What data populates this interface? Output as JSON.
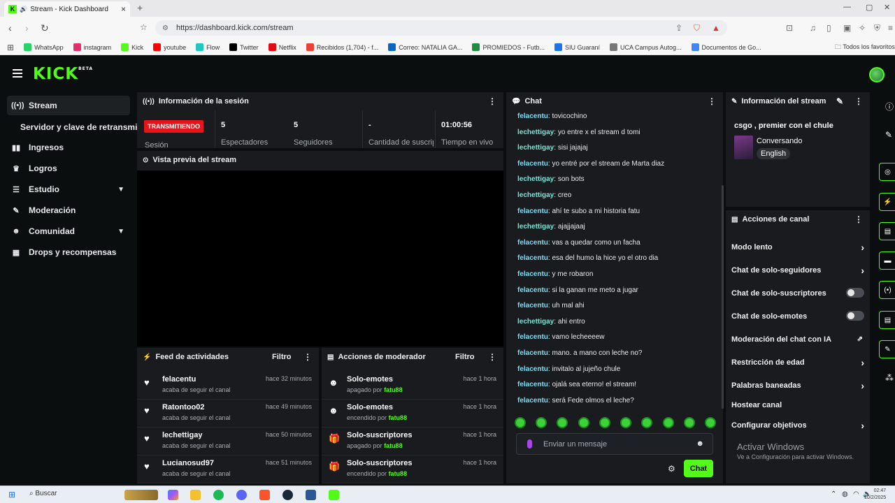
{
  "browser": {
    "tab_title": "Stream - Kick Dashboard",
    "url": "https://dashboard.kick.com/stream",
    "bookmarks": [
      "WhatsApp",
      "instagram",
      "Kick",
      "youtube",
      "Flow",
      "Twitter",
      "Netflix",
      "Recibidos (1,704) - f...",
      "Correo: NATALIA GA...",
      "PROMIEDOS - Futb...",
      "SIU Guaraní",
      "UCA Campus Autog...",
      "Documentos de Go..."
    ],
    "bookmark_colors": [
      "#25d366",
      "#e1306c",
      "#53fc18",
      "#ff0000",
      "#1fc9c1",
      "#000000",
      "#e50914",
      "#ea4335",
      "#0a66c2",
      "#1e8e3e",
      "#1a73e8",
      "#777777",
      "#4285f4"
    ],
    "other_bookmarks": "Todos los favoritos"
  },
  "kick": {
    "logo": "KICK",
    "logo_badge": "BETA"
  },
  "sidebar": {
    "items": [
      {
        "label": "Stream",
        "icon": "broadcast-icon",
        "glyph": "((•))"
      },
      {
        "label": "Ingresos",
        "icon": "chart-icon",
        "glyph": "▮"
      },
      {
        "label": "Logros",
        "icon": "trophy-icon",
        "glyph": "🏆"
      },
      {
        "label": "Estudio",
        "icon": "tune-icon",
        "glyph": "≡"
      },
      {
        "label": "Moderación",
        "icon": "wrench-icon",
        "glyph": "🔧"
      },
      {
        "label": "Comunidad",
        "icon": "people-icon",
        "glyph": "👥"
      },
      {
        "label": "Drops y recompensas",
        "icon": "gift-chart-icon",
        "glyph": "▦"
      }
    ],
    "sub_item": "Servidor y clave de retransmisión"
  },
  "session": {
    "title": "Información de la sesión",
    "status_badge": "TRANSMITIENDO",
    "status_label": "Sesión",
    "stats": [
      {
        "value": "5",
        "label": "Espectadores"
      },
      {
        "value": "5",
        "label": "Seguidores"
      },
      {
        "value": "-",
        "label": "Cantidad de suscripciones"
      },
      {
        "value": "01:00:56",
        "label": "Tiempo en vivo"
      }
    ],
    "preview_title": "Vista previa del stream"
  },
  "activity_feed": {
    "title": "Feed de actividades",
    "filter": "Filtro",
    "rows": [
      {
        "name": "felacentu",
        "sub": "acaba de seguir el canal",
        "time": "hace 32 minutos"
      },
      {
        "name": "Ratontoo02",
        "sub": "acaba de seguir el canal",
        "time": "hace 49 minutos"
      },
      {
        "name": "lechettigay",
        "sub": "acaba de seguir el canal",
        "time": "hace 50 minutos"
      },
      {
        "name": "Lucianosud97",
        "sub": "acaba de seguir el canal",
        "time": "hace 51 minutos"
      }
    ]
  },
  "mod_actions": {
    "title": "Acciones de moderador",
    "filter": "Filtro",
    "rows": [
      {
        "name": "Solo-emotes",
        "state": "apagado por",
        "by": "fatu88",
        "time": "hace 1 hora",
        "icon": "emote-icon"
      },
      {
        "name": "Solo-emotes",
        "state": "encendido por",
        "by": "fatu88",
        "time": "hace 1 hora",
        "icon": "emote-icon"
      },
      {
        "name": "Solo-suscriptores",
        "state": "apagado por",
        "by": "fatu88",
        "time": "hace 1 hora",
        "icon": "gift-icon"
      },
      {
        "name": "Solo-suscriptores",
        "state": "encendido por",
        "by": "fatu88",
        "time": "hace 1 hora",
        "icon": "gift-icon"
      }
    ]
  },
  "chat": {
    "title": "Chat",
    "messages": [
      {
        "user": "felacentu",
        "text": "tovicochino"
      },
      {
        "user": "lechettigay",
        "text": "yo entre x el stream d tomi"
      },
      {
        "user": "lechettigay",
        "text": "sisi jajajaj"
      },
      {
        "user": "felacentu",
        "text": "yo entré por el stream de Marta diaz"
      },
      {
        "user": "lechettigay",
        "text": "son bots"
      },
      {
        "user": "lechettigay",
        "text": "creo"
      },
      {
        "user": "felacentu",
        "text": "ahí te subo a mi historia fatu"
      },
      {
        "user": "lechettigay",
        "text": "ajajjajaaj"
      },
      {
        "user": "felacentu",
        "text": "vas a quedar como un facha"
      },
      {
        "user": "felacentu",
        "text": "esa del humo la hice yo el otro dia"
      },
      {
        "user": "felacentu",
        "text": "y me robaron"
      },
      {
        "user": "felacentu",
        "text": "si la ganan me meto a jugar"
      },
      {
        "user": "felacentu",
        "text": "uh mal ahi"
      },
      {
        "user": "lechettigay",
        "text": "ahi entro"
      },
      {
        "user": "felacentu",
        "text": "vamo lecheeeew"
      },
      {
        "user": "felacentu",
        "text": "mano. a mano con leche no?"
      },
      {
        "user": "felacentu",
        "text": "invitalo al jujeño chule"
      },
      {
        "user": "felacentu",
        "text": "ojalá sea eterno! el stream!"
      },
      {
        "user": "felacentu",
        "text": "será Fede olmos el leche?"
      }
    ],
    "input_placeholder": "Enviar un mensaje",
    "send_label": "Chat"
  },
  "stream_info": {
    "title": "Información del stream",
    "stream_title": "csgo , premier con el chule",
    "category": "Conversando",
    "language": "English"
  },
  "channel_actions": {
    "title": "Acciones de canal",
    "items": [
      {
        "label": "Modo lento",
        "kind": "arrow"
      },
      {
        "label": "Chat de solo-seguidores",
        "kind": "arrow"
      },
      {
        "label": "Chat de solo-suscriptores",
        "kind": "toggle",
        "on": false
      },
      {
        "label": "Chat de solo-emotes",
        "kind": "toggle",
        "on": false
      },
      {
        "label": "Moderación del chat con IA",
        "kind": "external"
      },
      {
        "label": "Restricción de edad",
        "kind": "arrow"
      },
      {
        "label": "Palabras baneadas",
        "kind": "arrow"
      },
      {
        "label": "Hostear canal",
        "kind": "none"
      },
      {
        "label": "Configurar objetivos",
        "kind": "arrow"
      }
    ]
  },
  "windows": {
    "activate_title": "Activar Windows",
    "activate_sub": "Ve a Configuración para activar Windows.",
    "search": "Buscar",
    "time": "02:47",
    "date": "10/2/2025"
  },
  "colors": {
    "accent": "#53fc18",
    "live": "#e6151b",
    "panel": "#191b1f",
    "background": "#0b0e0f"
  }
}
